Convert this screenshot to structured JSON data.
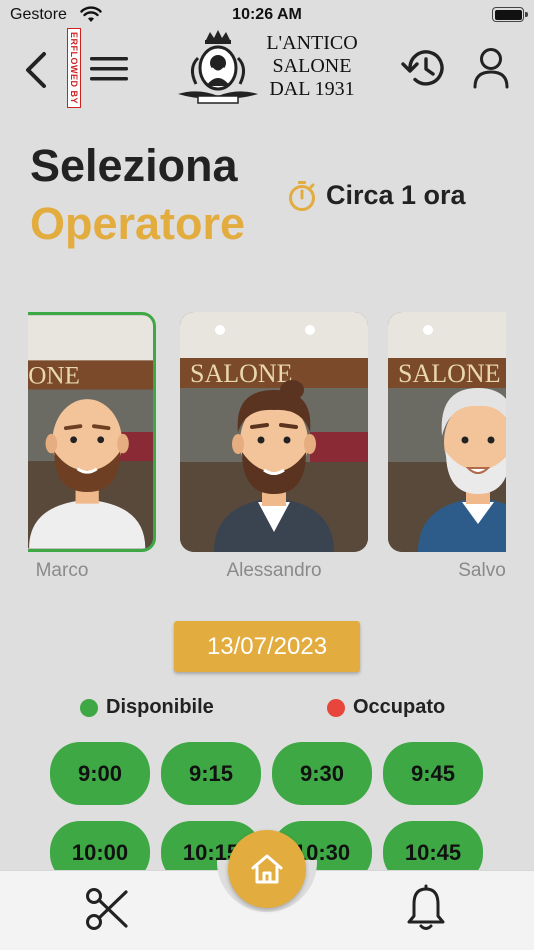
{
  "status_bar": {
    "carrier": "Gestore",
    "time": "10:26 AM"
  },
  "header": {
    "badge_text": "ERFLOWED BY",
    "logo_lines": [
      "L'ANTICO",
      "SALONE",
      "DAL 1931"
    ]
  },
  "title": {
    "line1": "Seleziona",
    "line2": "Operatore"
  },
  "duration": {
    "label": "Circa 1 ora"
  },
  "operators": [
    {
      "name": "Marco",
      "selected": true
    },
    {
      "name": "Alessandro",
      "selected": false
    },
    {
      "name": "Salvo",
      "selected": false
    }
  ],
  "date": {
    "value": "13/07/2023"
  },
  "legend": {
    "available": "Disponibile",
    "busy": "Occupato",
    "available_color": "#3ea845",
    "busy_color": "#e8453c"
  },
  "slots": [
    "9:00",
    "9:15",
    "9:30",
    "9:45",
    "10:00",
    "10:15",
    "10:30",
    "10:45"
  ],
  "colors": {
    "accent": "#e2ac3f",
    "available": "#3ea845",
    "background": "#dedede"
  },
  "bottom_nav": [
    {
      "icon": "scissors-icon"
    },
    {
      "icon": "home-icon"
    },
    {
      "icon": "bell-icon"
    }
  ]
}
